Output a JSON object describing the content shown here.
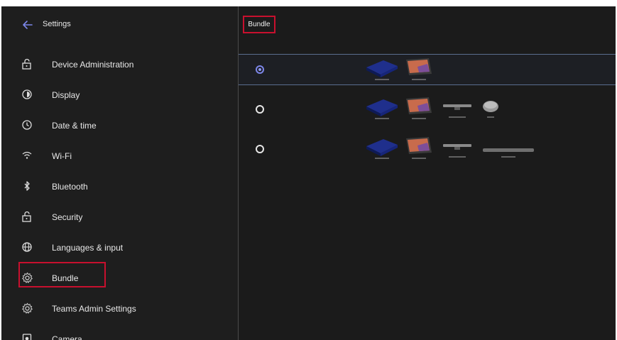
{
  "sidebar": {
    "title": "Settings",
    "items": [
      {
        "label": "Device Administration",
        "icon": "lock-icon"
      },
      {
        "label": "Display",
        "icon": "brightness-icon"
      },
      {
        "label": "Date & time",
        "icon": "clock-icon"
      },
      {
        "label": "Wi-Fi",
        "icon": "wifi-icon"
      },
      {
        "label": "Bluetooth",
        "icon": "bluetooth-icon"
      },
      {
        "label": "Security",
        "icon": "lock-icon"
      },
      {
        "label": "Languages & input",
        "icon": "globe-icon"
      },
      {
        "label": "Bundle",
        "icon": "gear-icon",
        "selected": true
      },
      {
        "label": "Teams Admin Settings",
        "icon": "gear-icon"
      },
      {
        "label": "Camera",
        "icon": "camera-icon"
      }
    ]
  },
  "content": {
    "title": "Bundle",
    "options": [
      {
        "selected": true,
        "devices": [
          "compute-module",
          "touch-console"
        ]
      },
      {
        "selected": false,
        "devices": [
          "compute-module",
          "touch-console",
          "camera-bar",
          "speakerphone"
        ]
      },
      {
        "selected": false,
        "devices": [
          "compute-module",
          "touch-console",
          "camera-bar",
          "soundbar"
        ]
      }
    ]
  },
  "colors": {
    "background": "#1b1b1b",
    "highlight_border": "#c8102e",
    "radio_selected": "#8e97f2",
    "back_arrow": "#7c86e8"
  }
}
